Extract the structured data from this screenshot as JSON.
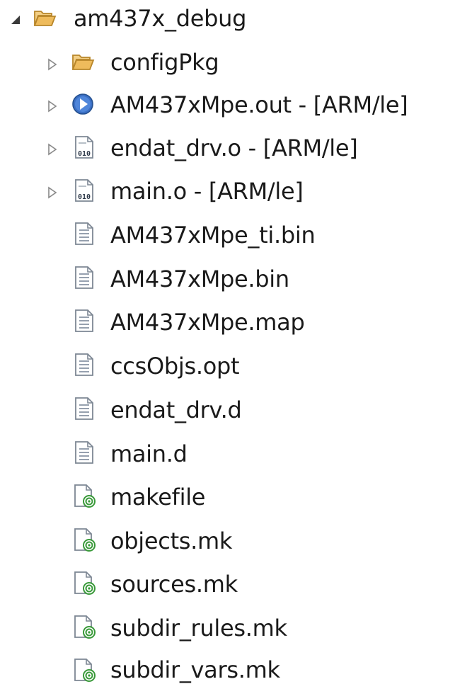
{
  "tree": {
    "root": {
      "label": "am437x_debug",
      "icon": "folder-open-icon",
      "expanded": true
    },
    "children": [
      {
        "label": "configPkg",
        "icon": "folder-open-icon",
        "expandable": true
      },
      {
        "label": "AM437xMpe.out - [ARM/le]",
        "icon": "executable-icon",
        "expandable": true
      },
      {
        "label": "endat_drv.o - [ARM/le]",
        "icon": "binary-object-icon",
        "expandable": true
      },
      {
        "label": "main.o - [ARM/le]",
        "icon": "binary-object-icon",
        "expandable": true
      },
      {
        "label": "AM437xMpe_ti.bin",
        "icon": "text-file-icon",
        "expandable": false
      },
      {
        "label": "AM437xMpe.bin",
        "icon": "text-file-icon",
        "expandable": false
      },
      {
        "label": "AM437xMpe.map",
        "icon": "text-file-icon",
        "expandable": false
      },
      {
        "label": "ccsObjs.opt",
        "icon": "text-file-icon",
        "expandable": false
      },
      {
        "label": "endat_drv.d",
        "icon": "text-file-icon",
        "expandable": false
      },
      {
        "label": "main.d",
        "icon": "text-file-icon",
        "expandable": false
      },
      {
        "label": "makefile",
        "icon": "makefile-icon",
        "expandable": false
      },
      {
        "label": "objects.mk",
        "icon": "makefile-icon",
        "expandable": false
      },
      {
        "label": "sources.mk",
        "icon": "makefile-icon",
        "expandable": false
      },
      {
        "label": "subdir_rules.mk",
        "icon": "makefile-icon",
        "expandable": false
      },
      {
        "label": "subdir_vars.mk",
        "icon": "makefile-icon",
        "expandable": false
      }
    ]
  },
  "colors": {
    "folder": "#e8b04a",
    "folder_dark": "#b8862a",
    "executable": "#3b6fc4",
    "file_outline": "#7d8794",
    "makefile_green": "#3a9a3a",
    "twisty": "#888888"
  }
}
